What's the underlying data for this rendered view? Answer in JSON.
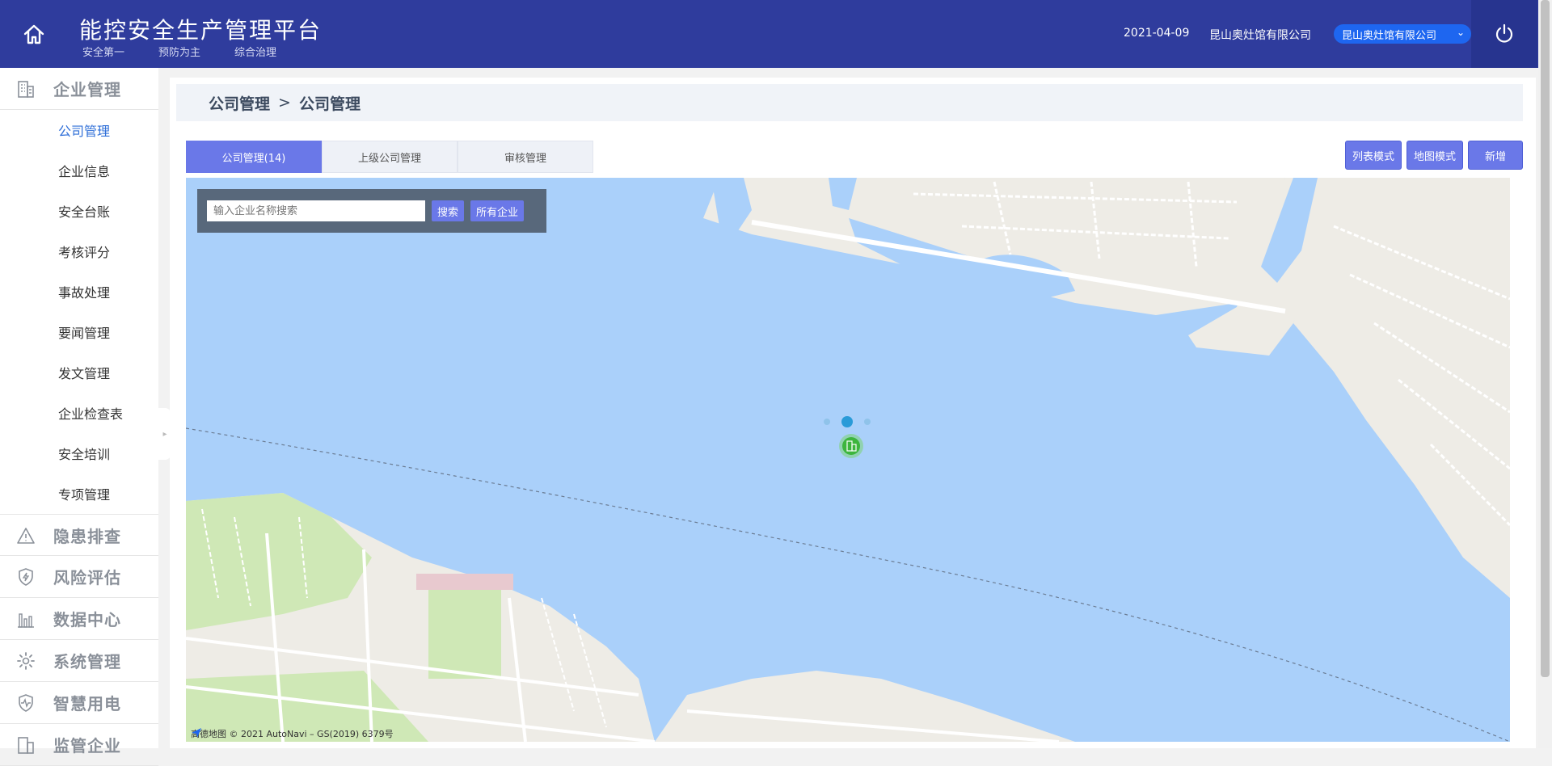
{
  "header": {
    "title": "能控安全生产管理平台",
    "slogans": [
      "安全第一",
      "预防为主",
      "综合治理"
    ],
    "date": "2021-04-09",
    "company": "昆山奥灶馆有限公司",
    "company_select": "昆山奥灶馆有限公司",
    "bg_color": "#2f3c9d"
  },
  "sidebar": {
    "sections": [
      {
        "label": "企业管理",
        "icon": "building-icon"
      },
      {
        "label": "隐患排查",
        "icon": "warning-icon"
      },
      {
        "label": "风险评估",
        "icon": "shield-bolt-icon"
      },
      {
        "label": "数据中心",
        "icon": "bar-chart-icon"
      },
      {
        "label": "系统管理",
        "icon": "gear-icon"
      },
      {
        "label": "智慧用电",
        "icon": "shield-pulse-icon"
      },
      {
        "label": "监管企业",
        "icon": "building-icon"
      }
    ],
    "items": [
      {
        "label": "公司管理",
        "active": true
      },
      {
        "label": "企业信息"
      },
      {
        "label": "安全台账"
      },
      {
        "label": "考核评分"
      },
      {
        "label": "事故处理"
      },
      {
        "label": "要闻管理"
      },
      {
        "label": "发文管理"
      },
      {
        "label": "企业检查表"
      },
      {
        "label": "安全培训"
      },
      {
        "label": "专项管理"
      }
    ]
  },
  "breadcrumb": {
    "level1": "公司管理",
    "separator": ">",
    "level2": "公司管理"
  },
  "tabs": [
    {
      "label": "公司管理(14)",
      "active": true
    },
    {
      "label": "上级公司管理"
    },
    {
      "label": "审核管理"
    }
  ],
  "actions": {
    "list_mode": "列表模式",
    "map_mode": "地图模式",
    "add": "新增"
  },
  "map": {
    "search_placeholder": "输入企业名称搜索",
    "search_button": "搜索",
    "all_button": "所有企业",
    "attribution": "高德地图 © 2021 AutoNavi  –  GS(2019) 6379号",
    "water_color": "#aad0fa",
    "land_color": "#eeece6",
    "park_color": "#cfe8b6",
    "marker_color": "#3db53d"
  }
}
